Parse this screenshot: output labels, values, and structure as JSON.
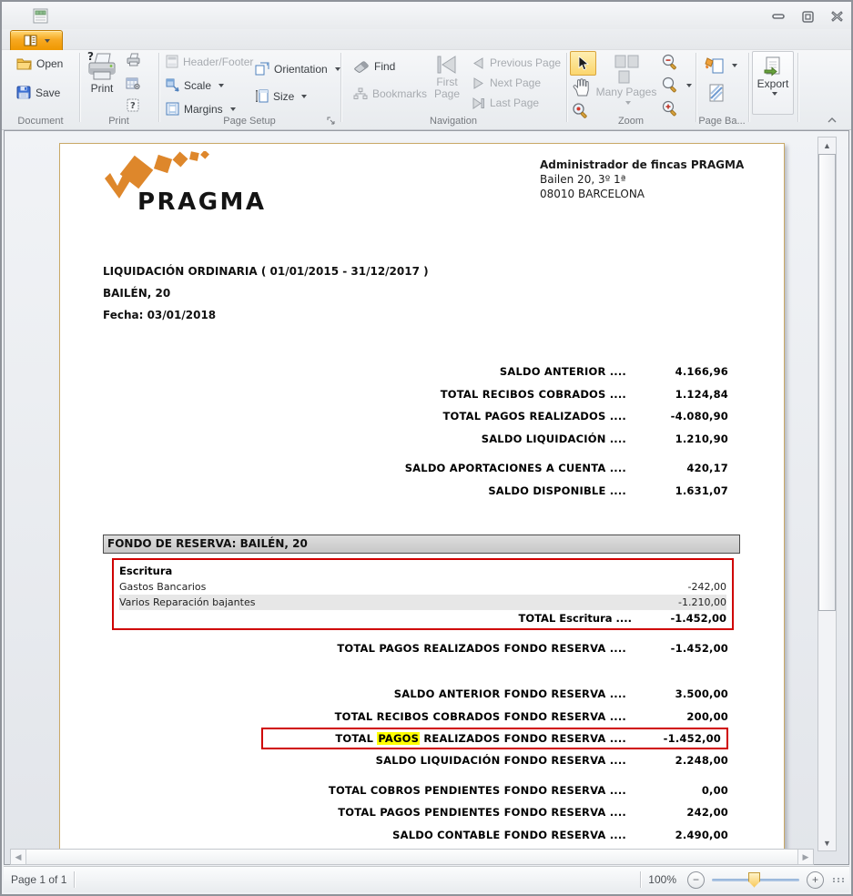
{
  "window": {
    "app_icon": "report-preview"
  },
  "ribbon": {
    "groups": {
      "document": {
        "label": "Document",
        "open": "Open",
        "save": "Save"
      },
      "print": {
        "label": "Print",
        "print": "Print"
      },
      "page_setup": {
        "label": "Page Setup",
        "header_footer": "Header/Footer",
        "scale": "Scale",
        "margins": "Margins",
        "orientation": "Orientation",
        "size": "Size"
      },
      "navigation": {
        "label": "Navigation",
        "find": "Find",
        "bookmarks": "Bookmarks",
        "first_page": "First Page",
        "previous_page": "Previous Page",
        "next_page": "Next  Page",
        "last_page": "Last  Page"
      },
      "zoom": {
        "label": "Zoom",
        "many_pages": "Many Pages"
      },
      "page_background": {
        "label": "Page Ba..."
      },
      "export": {
        "label": "Export",
        "export": "Export"
      }
    }
  },
  "document": {
    "logo_text": "PRAGMA",
    "sender": {
      "company": "Administrador de fincas PRAGMA",
      "line2": "Bailen 20, 3º 1ª",
      "line3": "08010 BARCELONA"
    },
    "title": "LIQUIDACIÓN ORDINARIA ( 01/01/2015 - 31/12/2017 )",
    "subtitle": "BAILÉN, 20",
    "date_line": "Fecha: 03/01/2018",
    "summary_rows": [
      {
        "label": "SALDO ANTERIOR ....",
        "value": "4.166,96"
      },
      {
        "label": "TOTAL RECIBOS COBRADOS ....",
        "value": "1.124,84"
      },
      {
        "label": "TOTAL PAGOS REALIZADOS ....",
        "value": "-4.080,90"
      },
      {
        "label": "SALDO LIQUIDACIÓN ....",
        "value": "1.210,90"
      },
      {
        "label": "SALDO APORTACIONES A CUENTA ....",
        "value": "420,17",
        "gap_before": true
      },
      {
        "label": "SALDO DISPONIBLE ....",
        "value": "1.631,07"
      }
    ],
    "fondo": {
      "header": "FONDO DE RESERVA: BAILÉN, 20",
      "escritura": {
        "title": "Escritura",
        "rows": [
          {
            "label": "Gastos Bancarios",
            "value": "-242,00",
            "shaded": false
          },
          {
            "label": "Varios Reparación bajantes",
            "value": "-1.210,00",
            "shaded": true
          }
        ],
        "total_label": "TOTAL Escritura ....",
        "total_value": "-1.452,00"
      },
      "total_row": {
        "label": "TOTAL PAGOS REALIZADOS FONDO RESERVA ....",
        "value": "-1.452,00"
      },
      "rows": [
        {
          "label": "SALDO ANTERIOR FONDO RESERVA ....",
          "value": "3.500,00"
        },
        {
          "label": "TOTAL RECIBOS COBRADOS FONDO RESERVA ....",
          "value": "200,00"
        },
        {
          "label_pre": "TOTAL ",
          "label_highlight": "PAGOS",
          "label_post": " REALIZADOS FONDO RESERVA ....",
          "value": "-1.452,00",
          "boxed": true
        },
        {
          "label": "SALDO LIQUIDACIÓN FONDO RESERVA ....",
          "value": "2.248,00"
        },
        {
          "label": "TOTAL COBROS PENDIENTES FONDO RESERVA ....",
          "value": "0,00",
          "gap_before": true
        },
        {
          "label": "TOTAL PAGOS PENDIENTES FONDO RESERVA ....",
          "value": "242,00"
        },
        {
          "label": "SALDO CONTABLE FONDO RESERVA ....",
          "value": "2.490,00"
        }
      ]
    }
  },
  "statusbar": {
    "page_info": "Page 1 of 1",
    "zoom_value": "100%"
  },
  "colors": {
    "logo_orange": "#de872b",
    "highlight_yellow": "#ffff00",
    "alert_red": "#cf0000",
    "app_button_orange": "#f7a922",
    "section_header_bg": "#d2d2d2"
  }
}
